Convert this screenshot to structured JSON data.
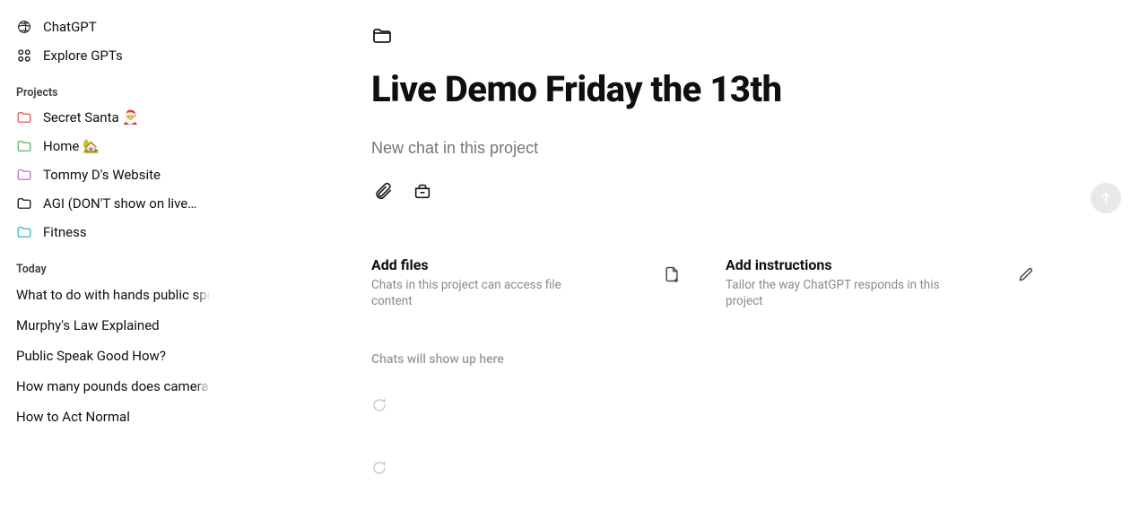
{
  "sidebar": {
    "nav": {
      "chatgpt_label": "ChatGPT",
      "explore_label": "Explore GPTs"
    },
    "projects_section_label": "Projects",
    "projects": [
      {
        "label": "Secret Santa 🎅",
        "folder_color": "#e15858"
      },
      {
        "label": "Home 🏡",
        "folder_color": "#57b66b"
      },
      {
        "label": "Tommy D's Website",
        "folder_color": "#c86bd6"
      },
      {
        "label": "AGI (DON'T show on live…",
        "folder_color": "#1a1a1a"
      },
      {
        "label": "Fitness",
        "folder_color": "#38b8c7"
      }
    ],
    "today_section_label": "Today",
    "today": [
      {
        "label": "What to do with hands public speaking"
      },
      {
        "label": "Murphy's Law Explained"
      },
      {
        "label": "Public Speak Good How?"
      },
      {
        "label": "How many pounds does camera add"
      },
      {
        "label": "How to Act Normal"
      }
    ]
  },
  "project": {
    "title": "Live Demo Friday the 13th",
    "compose_placeholder": "New chat in this project",
    "add_files": {
      "title": "Add files",
      "subtitle": "Chats in this project can access file content"
    },
    "add_instructions": {
      "title": "Add instructions",
      "subtitle": "Tailor the way ChatGPT responds in this project"
    },
    "empty_label": "Chats will show up here"
  }
}
